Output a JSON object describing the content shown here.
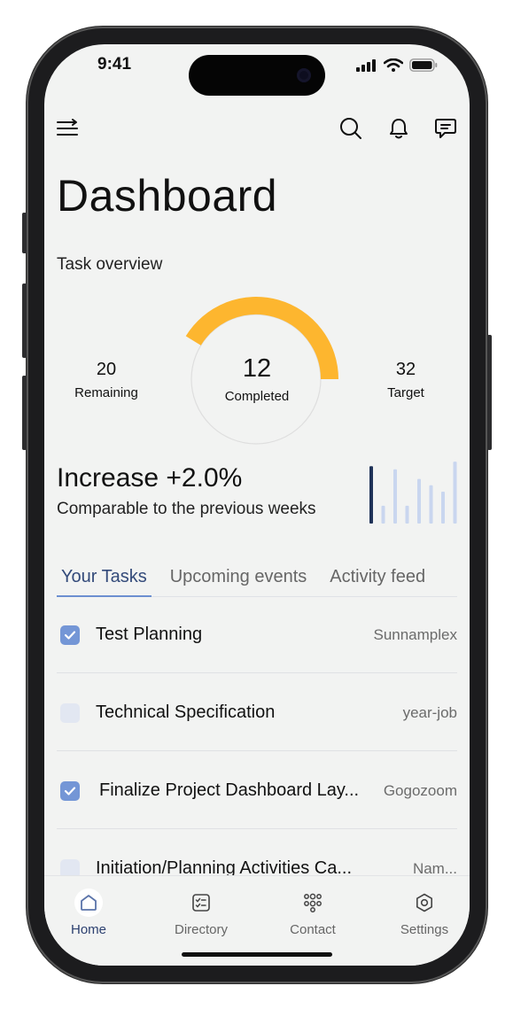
{
  "status_bar": {
    "time": "9:41"
  },
  "header": {
    "icons": [
      "menu-icon",
      "search-icon",
      "bell-icon",
      "message-icon"
    ],
    "title": "Dashboard"
  },
  "overview": {
    "label": "Task overview",
    "remaining": {
      "value": "20",
      "label": "Remaining"
    },
    "completed": {
      "value": "12",
      "label": "Completed"
    },
    "target": {
      "value": "32",
      "label": "Target"
    },
    "progress_fraction": 0.375,
    "accent_color": "#FDB62F"
  },
  "trend": {
    "headline": "Increase +2.0%",
    "subtitle": "Comparable to the previous weeks",
    "bar_levels": [
      0.9,
      0.28,
      0.85,
      0.28,
      0.7,
      0.6,
      0.5,
      0.97
    ],
    "highlight_color": "#1f3258",
    "muted_color": "#c9d6ef"
  },
  "tabs": [
    {
      "label": "Your Tasks",
      "active": true
    },
    {
      "label": "Upcoming events",
      "active": false
    },
    {
      "label": "Activity feed",
      "active": false
    }
  ],
  "tasks": [
    {
      "name": "Test Planning",
      "org": "Sunnamplex",
      "done": true
    },
    {
      "name": "Technical Specification",
      "org": "year-job",
      "done": false
    },
    {
      "name": "Finalize Project Dashboard Lay...",
      "org": "Gogozoom",
      "done": true
    },
    {
      "name": "Initiation/Planning Activities Ca...",
      "org": "Nam...",
      "done": false
    }
  ],
  "nav": [
    {
      "label": "Home",
      "icon": "home-icon",
      "active": true
    },
    {
      "label": "Directory",
      "icon": "directory-icon",
      "active": false
    },
    {
      "label": "Contact",
      "icon": "contact-icon",
      "active": false
    },
    {
      "label": "Settings",
      "icon": "settings-icon",
      "active": false
    }
  ]
}
